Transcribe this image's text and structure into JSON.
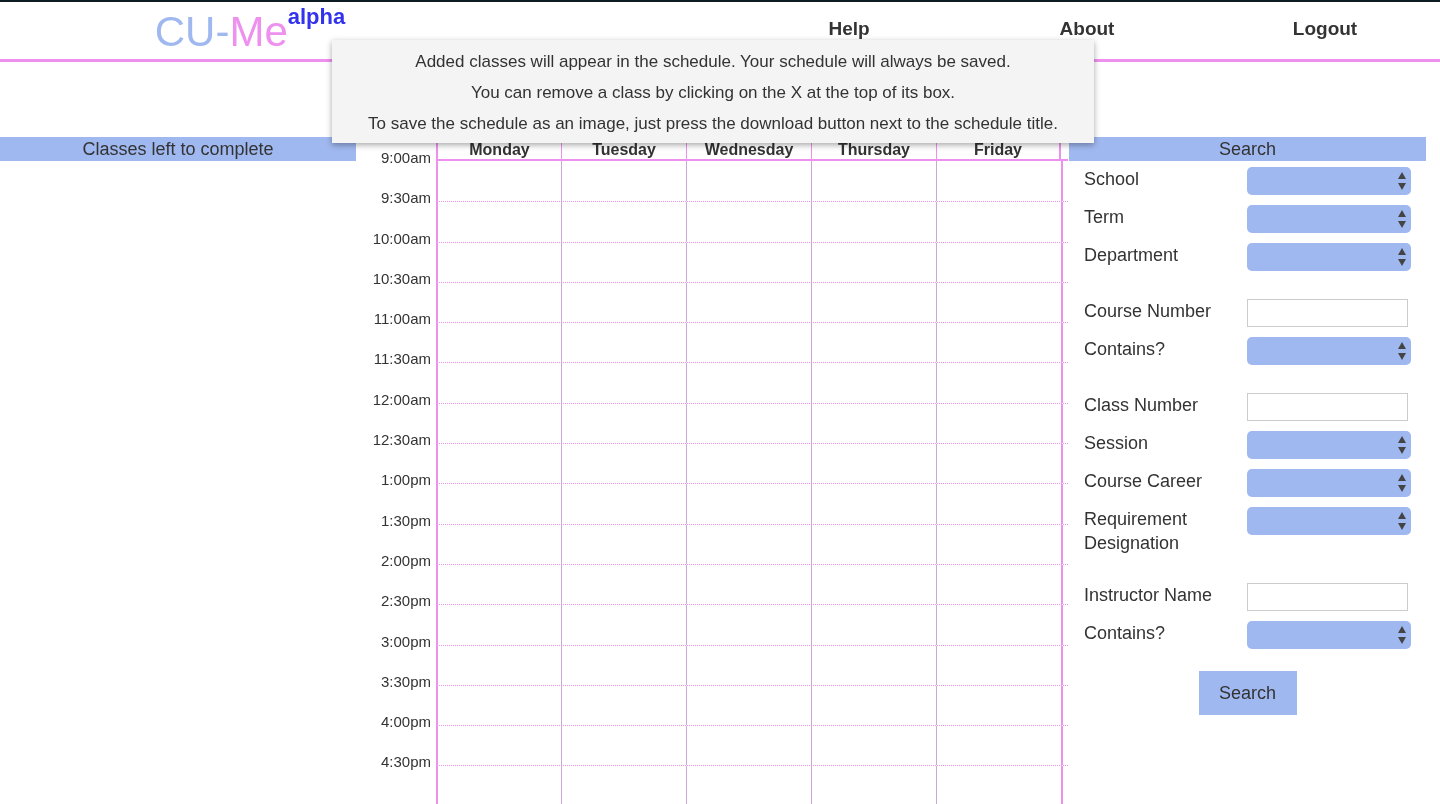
{
  "header": {
    "logo": {
      "part_1": "CU-",
      "part_2": "Me",
      "superscript": "alpha"
    },
    "nav": [
      "Help",
      "About",
      "Logout"
    ]
  },
  "tooltip": [
    "Added classes will appear in the schedule. Your schedule will always be saved.",
    "You can remove a class by clicking on the X at the top of its box.",
    "To save the schedule as an image, just press the download button next to the schedule title."
  ],
  "classes_panel": {
    "title": "Classes left to complete"
  },
  "schedule": {
    "days": [
      "Monday",
      "Tuesday",
      "Wednesday",
      "Thursday",
      "Friday"
    ],
    "times": [
      "9:00am",
      "9:30am",
      "10:00am",
      "10:30am",
      "11:00am",
      "11:30am",
      "12:00am",
      "12:30am",
      "1:00pm",
      "1:30pm",
      "2:00pm",
      "2:30pm",
      "3:00pm",
      "3:30pm",
      "4:00pm",
      "4:30pm"
    ]
  },
  "search": {
    "title": "Search",
    "groups": [
      [
        {
          "label": "School",
          "kind": "select"
        },
        {
          "label": "Term",
          "kind": "select"
        },
        {
          "label": "Department",
          "kind": "select"
        }
      ],
      [
        {
          "label": "Course Number",
          "kind": "text"
        },
        {
          "label": "Contains?",
          "kind": "select"
        }
      ],
      [
        {
          "label": "Class Number",
          "kind": "text"
        },
        {
          "label": "Session",
          "kind": "select"
        },
        {
          "label": "Course Career",
          "kind": "select"
        },
        {
          "label": "Requirement Designation",
          "kind": "select"
        }
      ],
      [
        {
          "label": "Instructor Name",
          "kind": "text"
        },
        {
          "label": "Contains?",
          "kind": "select"
        }
      ]
    ],
    "button": "Search"
  }
}
